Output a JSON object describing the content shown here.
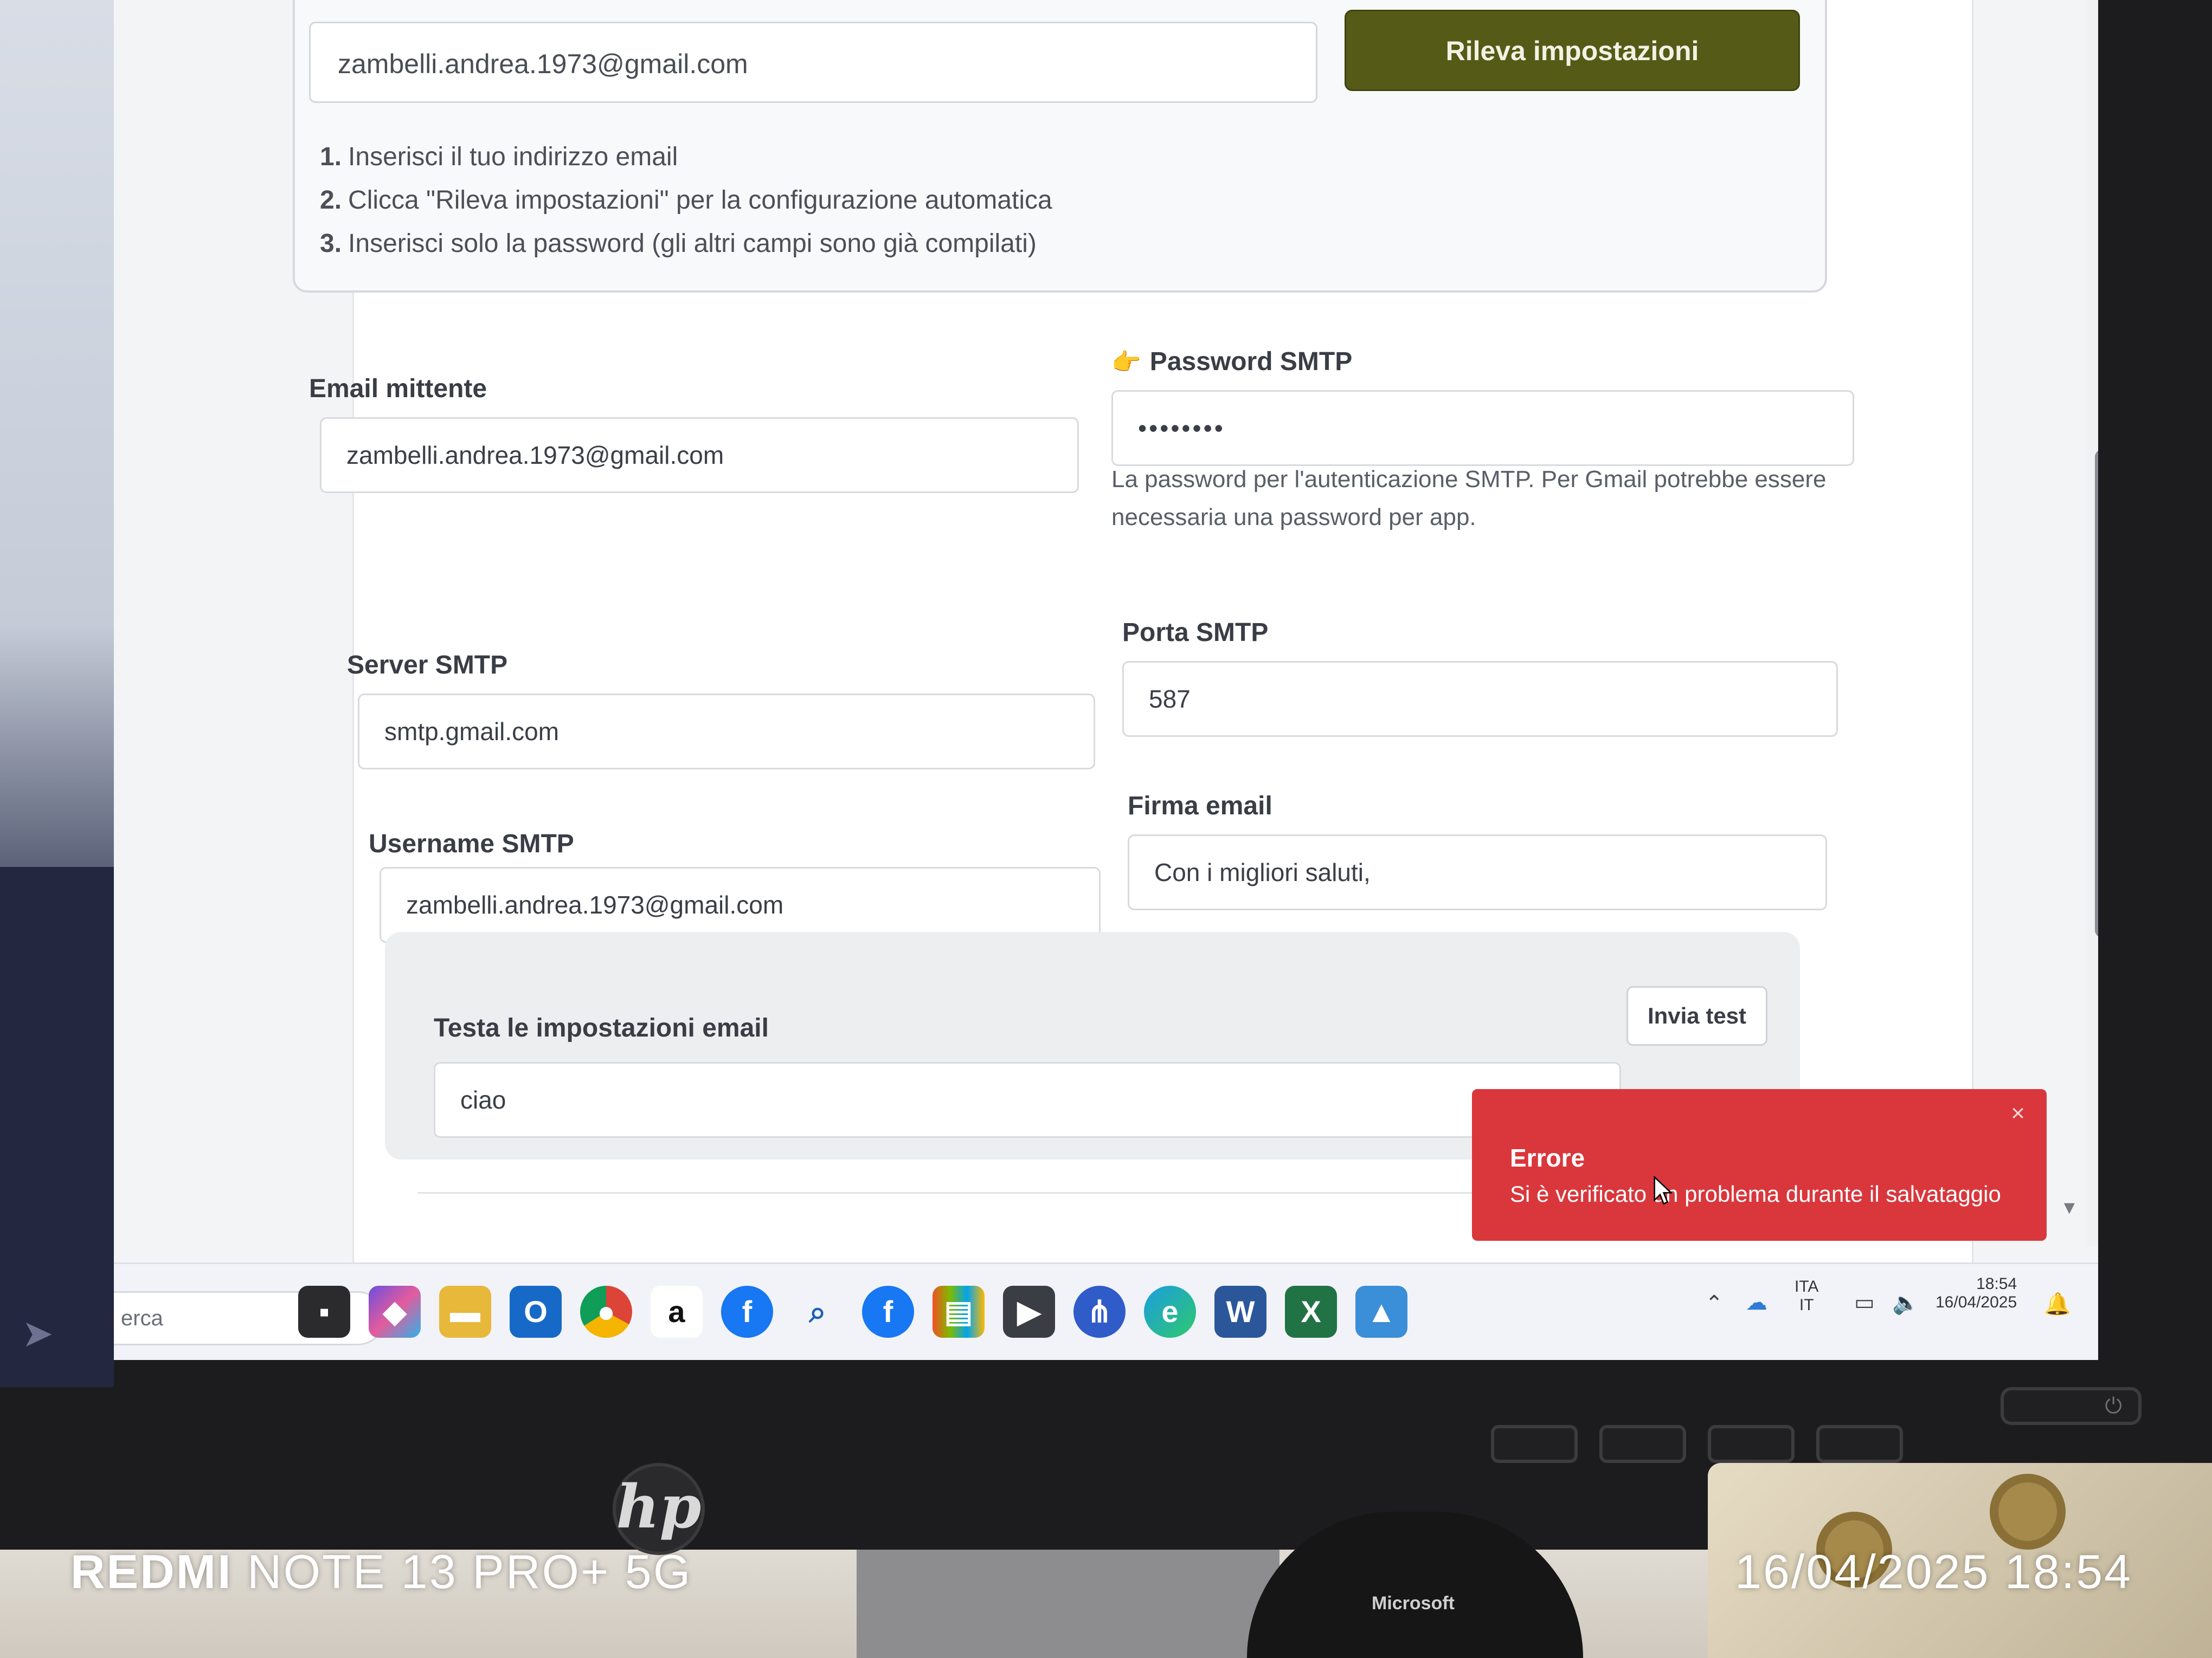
{
  "autodetect": {
    "email_value": "zambelli.andrea.1973@gmail.com",
    "button_label": "Rileva impostazioni",
    "steps": [
      {
        "num": "1.",
        "text": "Inserisci il tuo indirizzo email"
      },
      {
        "num": "2.",
        "text": "Clicca \"Rileva impostazioni\" per la configurazione automatica"
      },
      {
        "num": "3.",
        "text": "Inserisci solo la password (gli altri campi sono già compilati)"
      }
    ]
  },
  "form": {
    "sender_email": {
      "label": "Email mittente",
      "value": "zambelli.andrea.1973@gmail.com"
    },
    "smtp_password": {
      "label": "Password SMTP",
      "value": "••••••••",
      "help": "La password per l'autenticazione SMTP. Per Gmail potrebbe essere necessaria una password per app."
    },
    "smtp_server": {
      "label": "Server SMTP",
      "value": "smtp.gmail.com"
    },
    "smtp_port": {
      "label": "Porta SMTP",
      "value": "587"
    },
    "smtp_username": {
      "label": "Username SMTP",
      "value": "zambelli.andrea.1973@gmail.com"
    },
    "signature": {
      "label": "Firma email",
      "value": "Con i migliori saluti,"
    }
  },
  "test": {
    "label": "Testa le impostazioni email",
    "value": "ciao",
    "button_label": "Invia test"
  },
  "toast": {
    "title": "Errore",
    "message": "Si è verificato un problema durante il salvataggio",
    "close": "×",
    "color": "#d9373c"
  },
  "taskbar": {
    "search_placeholder": "erca",
    "icons": [
      "task-view-icon",
      "m365-icon",
      "file-explorer-icon",
      "outlook-icon",
      "chrome-icon",
      "amazon-icon",
      "facebook-icon",
      "search-icon",
      "facebook-icon",
      "store-icon",
      "media-player-icon",
      "share-icon",
      "edge-icon",
      "word-icon",
      "excel-icon",
      "photos-icon"
    ],
    "lang_top": "ITA",
    "lang_bottom": "IT",
    "time": "18:54",
    "date": "16/04/2025"
  },
  "device": {
    "brand_logo": "hp",
    "mouse_brand": "Microsoft"
  },
  "camera_watermark": {
    "model_bold": "REDMI",
    "model_rest": "NOTE 13 PRO+ 5G",
    "timestamp": "16/04/2025 18:54"
  },
  "colors": {
    "accent_button": "#565a17",
    "error_red": "#d9373c"
  }
}
